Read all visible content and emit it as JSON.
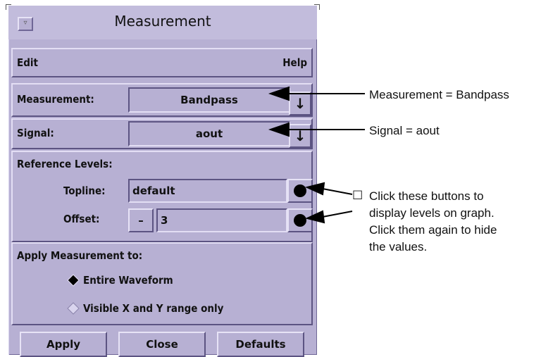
{
  "window": {
    "title": "Measurement",
    "menu_glyph": "▿"
  },
  "menubar": {
    "edit": "Edit",
    "help": "Help"
  },
  "measurement": {
    "label": "Measurement:",
    "value": "Bandpass",
    "dropdown_glyph": "↓"
  },
  "signal": {
    "label": "Signal:",
    "value": "aout",
    "dropdown_glyph": "↓"
  },
  "reference_levels": {
    "heading": "Reference Levels:",
    "topline_label": "Topline:",
    "topline_value": "default",
    "offset_label": "Offset:",
    "offset_sign": "–",
    "offset_value": "3"
  },
  "apply_to": {
    "heading": "Apply Measurement to:",
    "options": [
      {
        "label": "Entire Waveform",
        "selected": true
      },
      {
        "label": "Visible X and Y range only",
        "selected": false
      }
    ]
  },
  "buttons": {
    "apply": "Apply",
    "close": "Close",
    "defaults": "Defaults"
  },
  "annotations": {
    "measurement": "Measurement = Bandpass",
    "signal": "Signal = aout",
    "buttons_line1": "Click these buttons to",
    "buttons_line2": "display levels on graph.",
    "buttons_line3": "Click them again to hide",
    "buttons_line4": "the values.",
    "bullet": "☐"
  },
  "colors": {
    "dialog_bg": "#b7b0d3",
    "shadow": "#5c5482",
    "highlight": "#e3def4"
  }
}
